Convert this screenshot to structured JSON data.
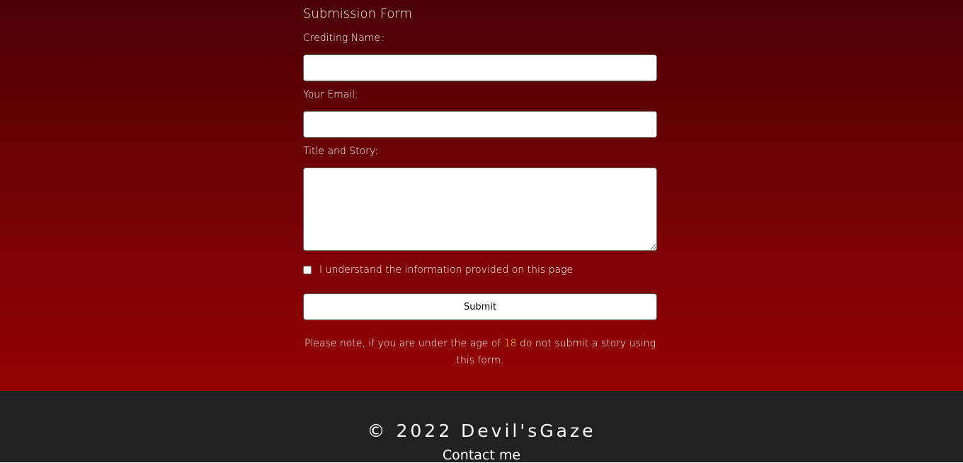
{
  "form": {
    "title": "Submission Form",
    "crediting_name_label": "Crediting Name:",
    "crediting_name_value": "",
    "email_label": "Your Email:",
    "email_value": "",
    "story_label": "Title and Story:",
    "story_value": "",
    "checkbox_label": "I understand the information provided on this page",
    "checkbox_checked": false,
    "submit_label": "Submit"
  },
  "note": {
    "before": "Please note, if you are under the age of ",
    "age": "18",
    "after": " do not submit a story using this form."
  },
  "footer": {
    "copyright": "© 2022 Devil'sGaze",
    "contact_link": "Contact me"
  },
  "colors": {
    "gradient_top": "#4b0004",
    "gradient_bottom": "#950203",
    "footer_bg": "#212121",
    "age_highlight": "#ffcc00"
  }
}
